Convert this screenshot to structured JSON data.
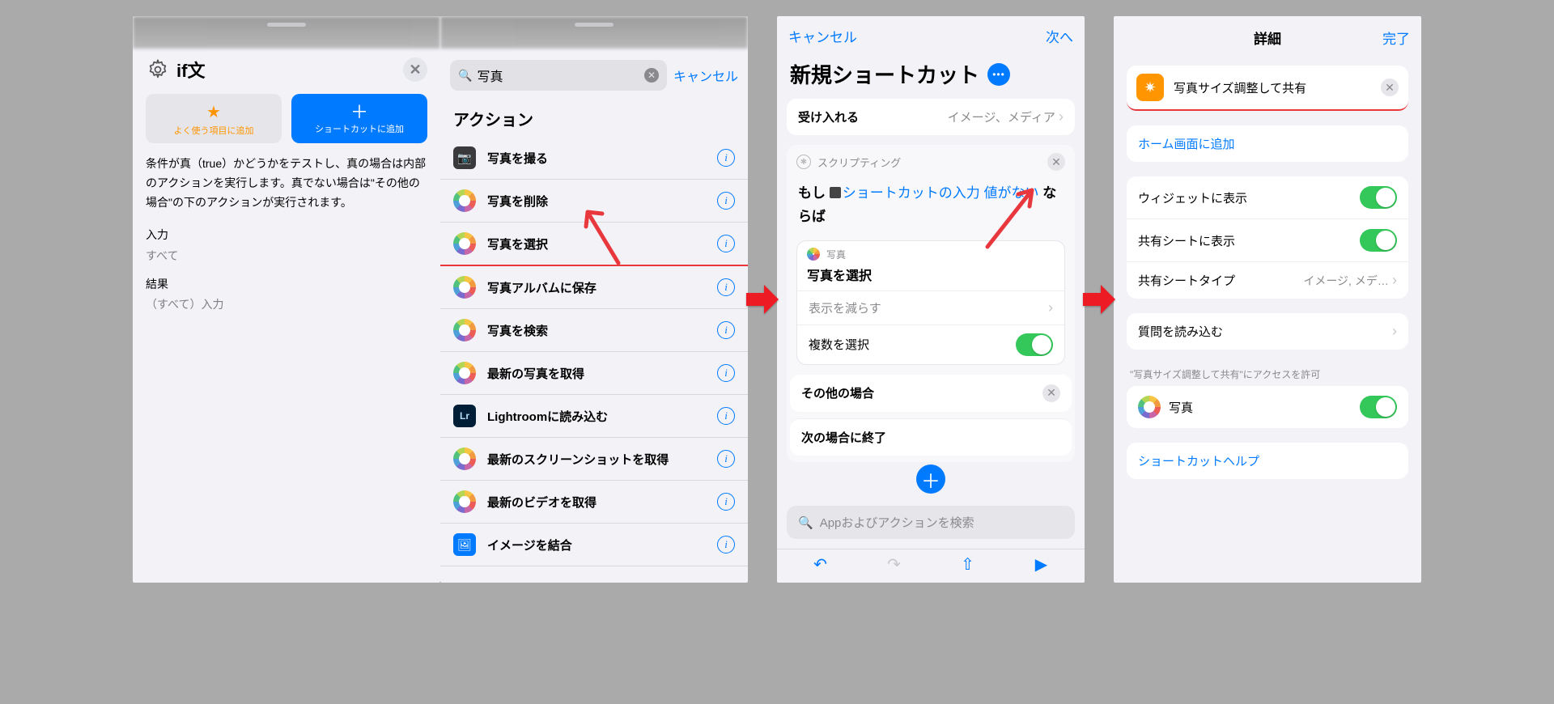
{
  "s1": {
    "title": "if文",
    "btn_fav": "よく使う項目に追加",
    "btn_add": "ショートカットに追加",
    "desc": "条件が真（true）かどうかをテストし、真の場合は内部のアクションを実行します。真でない場合は\"その他の場合\"の下のアクションが実行されます。",
    "input_k": "入力",
    "input_v": "すべて",
    "result_k": "結果",
    "result_v": "（すべて）入力"
  },
  "s2": {
    "search": "写真",
    "cancel": "キャンセル",
    "section": "アクション",
    "rows": [
      {
        "label": "写真を撮る",
        "icon": "camera"
      },
      {
        "label": "写真を削除",
        "icon": "photos"
      },
      {
        "label": "写真を選択",
        "icon": "photos",
        "hl": true
      },
      {
        "label": "写真アルバムに保存",
        "icon": "photos"
      },
      {
        "label": "写真を検索",
        "icon": "photos"
      },
      {
        "label": "最新の写真を取得",
        "icon": "photos"
      },
      {
        "label": "Lightroomに読み込む",
        "icon": "lr"
      },
      {
        "label": "最新のスクリーンショットを取得",
        "icon": "photos"
      },
      {
        "label": "最新のビデオを取得",
        "icon": "photos"
      },
      {
        "label": "イメージを結合",
        "icon": "img"
      }
    ]
  },
  "s3": {
    "cancel": "キャンセル",
    "next": "次へ",
    "title": "新規ショートカット",
    "accept_label": "受け入れる",
    "accept_value": "イメージ、メディア",
    "card_head": "スクリプティング",
    "cond_if": "もし",
    "cond_input": "ショートカットの入力",
    "cond_value": "値がない",
    "cond_then": "ならば",
    "photo_app": "写真",
    "photo_title": "写真を選択",
    "reduce": "表示を減らす",
    "multi": "複数を選択",
    "otherwise": "その他の場合",
    "endif": "次の場合に終了",
    "search_ph": "Appおよびアクションを検索"
  },
  "s4": {
    "title": "詳細",
    "done": "完了",
    "sc_name": "写真サイズ調整して共有",
    "add_home": "ホーム画面に追加",
    "show_widget": "ウィジェットに表示",
    "show_share": "共有シートに表示",
    "share_type_k": "共有シートタイプ",
    "share_type_v": "イメージ, メデ…",
    "import_q": "質問を読み込む",
    "perm_caption": "\"写真サイズ調整して共有\"にアクセスを許可",
    "perm_photos": "写真",
    "help": "ショートカットヘルプ"
  }
}
